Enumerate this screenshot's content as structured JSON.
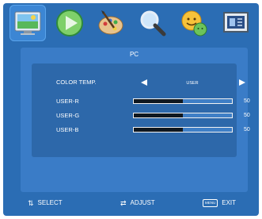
{
  "icons": [
    {
      "name": "picture-icon",
      "active": true
    },
    {
      "name": "play-icon",
      "active": false
    },
    {
      "name": "palette-icon",
      "active": false
    },
    {
      "name": "magnifier-icon",
      "active": false
    },
    {
      "name": "emoticon-icon",
      "active": false
    },
    {
      "name": "screen-adjust-icon",
      "active": false
    }
  ],
  "panel": {
    "title": "PC",
    "color_temp": {
      "label": "COLOR TEMP.",
      "value": "USER"
    },
    "rows": [
      {
        "label": "USER-R",
        "value": "50",
        "level": 0.5
      },
      {
        "label": "USER-G",
        "value": "50",
        "level": 0.5
      },
      {
        "label": "USER-B",
        "value": "50",
        "level": 0.5
      }
    ]
  },
  "footer": {
    "select_label": "SELECT",
    "adjust_label": "ADJUST",
    "menu_key": "MENU",
    "exit_label": "EXIT"
  },
  "colors": {
    "background": "#2b6db4",
    "panel": "#3a7cc7",
    "inner": "#2d68aa",
    "bar_fill": "#101820"
  }
}
